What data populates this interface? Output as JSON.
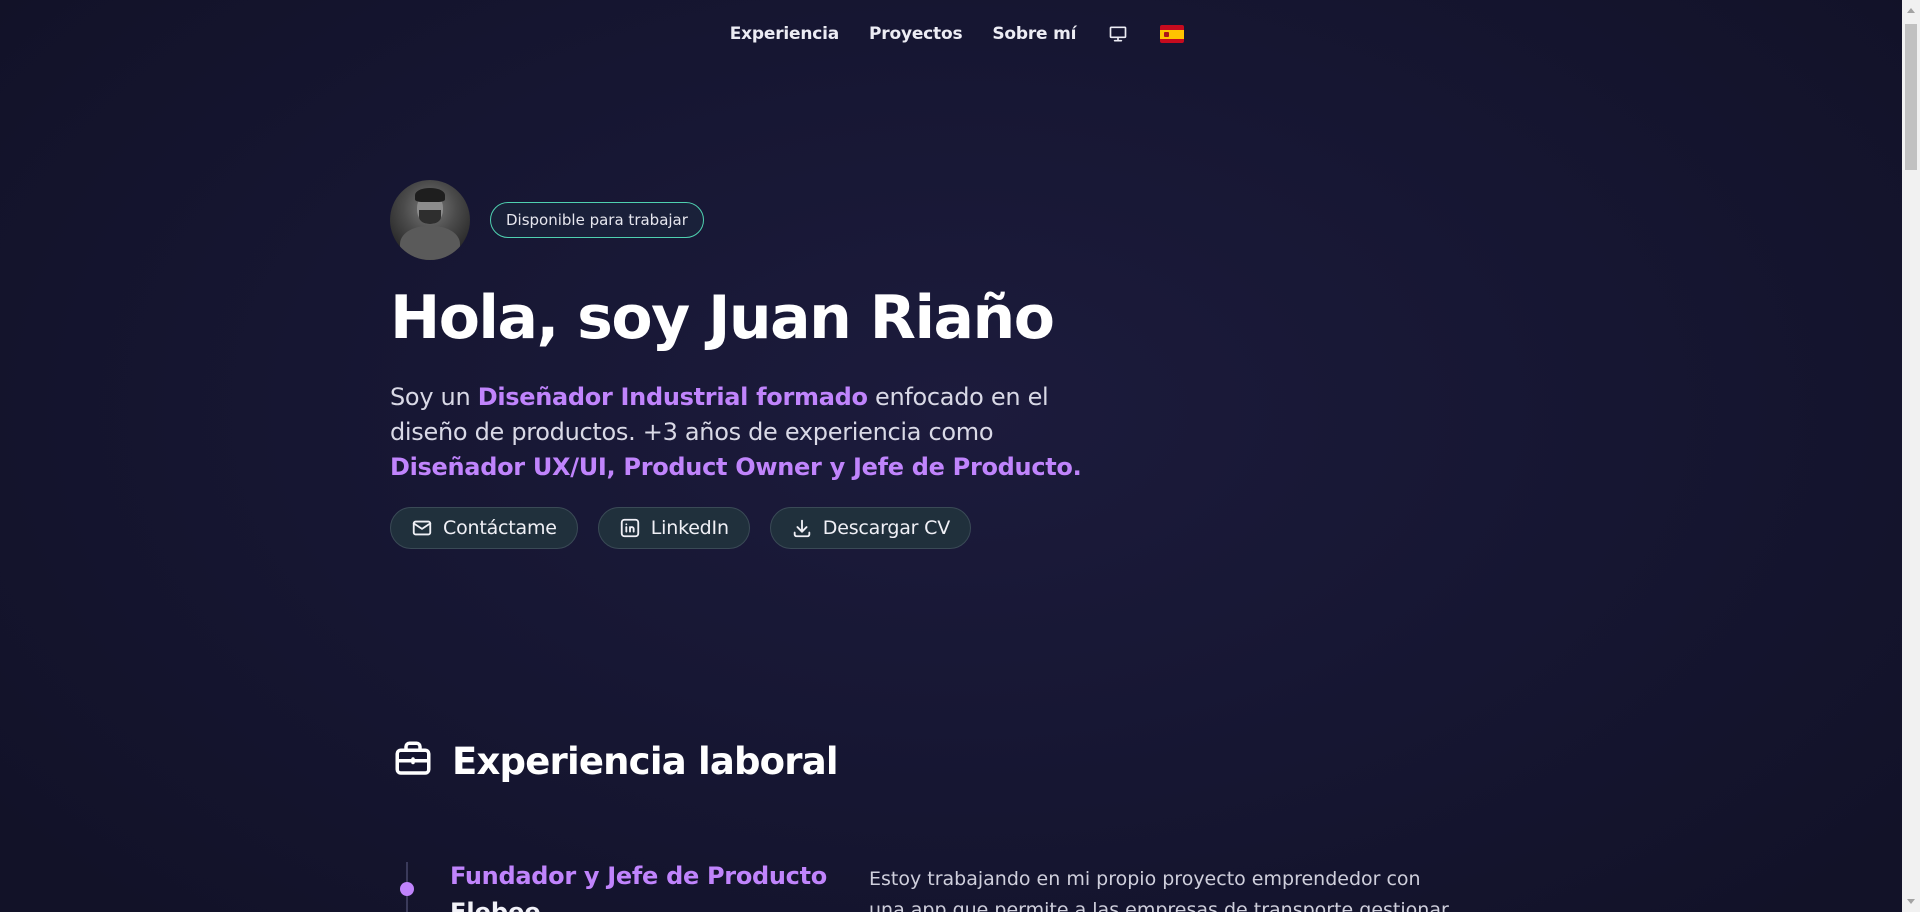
{
  "nav": {
    "items": [
      {
        "label": "Experiencia"
      },
      {
        "label": "Proyectos"
      },
      {
        "label": "Sobre mí"
      }
    ],
    "theme_icon": "monitor-icon",
    "language_icon": "spain-flag-icon"
  },
  "hero": {
    "avatar_icon": "profile-photo",
    "badge": "Disponible para trabajar",
    "title": "Hola, soy Juan Riaño",
    "intro": {
      "p1": "Soy un ",
      "h1": "Diseñador Industrial formado",
      "p2": " enfocado en el diseño de productos. +3 años de experiencia como ",
      "h2": "Diseñador UX/UI, Product Owner y Jefe de Producto."
    },
    "actions": [
      {
        "label": "Contáctame",
        "icon": "mail-icon"
      },
      {
        "label": "LinkedIn",
        "icon": "linkedin-icon"
      },
      {
        "label": "Descargar CV",
        "icon": "download-icon"
      }
    ]
  },
  "experience": {
    "heading": "Experiencia laboral",
    "icon": "briefcase-icon",
    "jobs": [
      {
        "title": "Fundador y Jefe de Producto",
        "company": "Flebee",
        "description": "Estoy trabajando en mi propio proyecto emprendedor con una app que permite a las empresas de transporte gestionar"
      }
    ]
  },
  "colors": {
    "accent": "#c084fc",
    "badge_border": "#4fd1b0",
    "background": "#161632"
  }
}
